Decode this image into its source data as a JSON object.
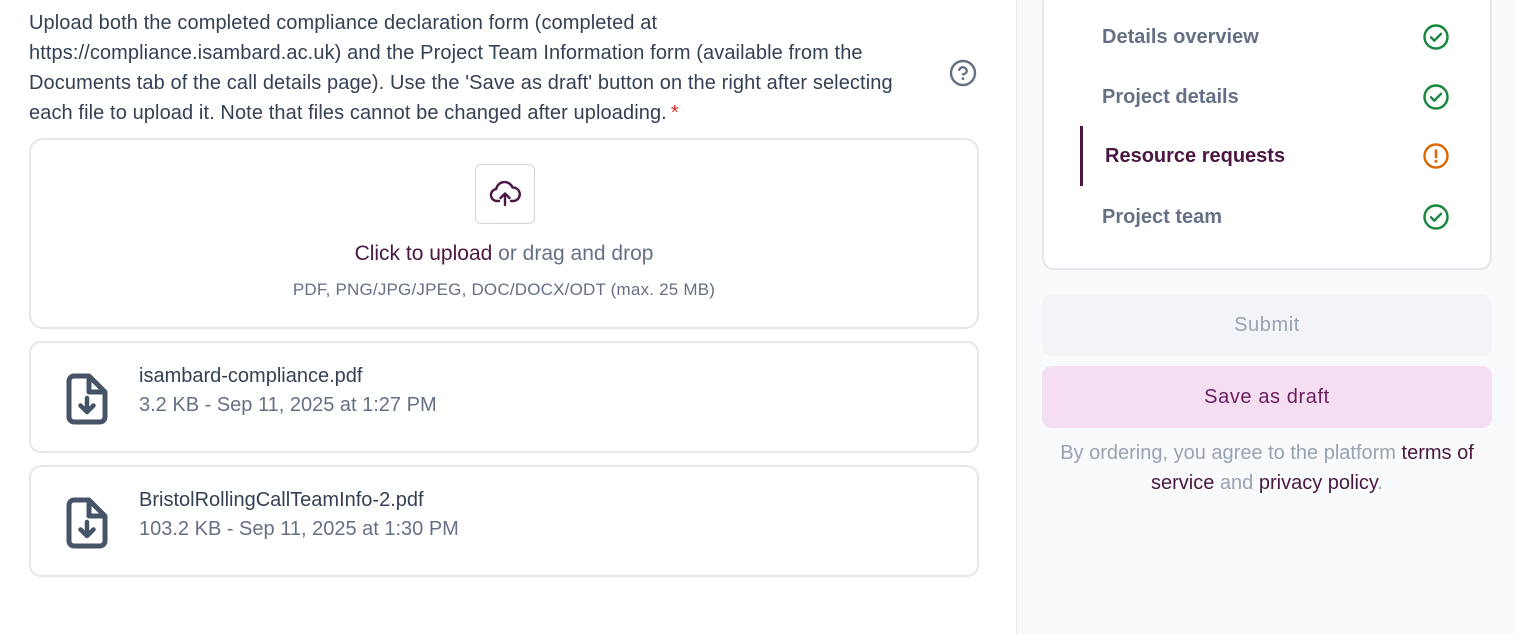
{
  "form": {
    "instructions": "Upload both the completed compliance declaration form (completed at https://compliance.isambard.ac.uk) and the Project Team Information form (available from the Documents tab of the call details page). Use the 'Save as draft' button on the right after selecting each file to upload it. Note that files cannot be changed after uploading.",
    "required_marker": "*",
    "dropzone": {
      "click_label": "Click to upload",
      "drag_label": " or drag and drop",
      "hint": "PDF, PNG/JPG/JPEG, DOC/DOCX/ODT (max. 25 MB)"
    },
    "files": [
      {
        "name": "isambard-compliance.pdf",
        "meta": "3.2 KB - Sep 11, 2025 at 1:27 PM"
      },
      {
        "name": "BristolRollingCallTeamInfo-2.pdf",
        "meta": "103.2 KB - Sep 11, 2025 at 1:30 PM"
      }
    ]
  },
  "sidebar": {
    "steps": [
      {
        "label": "Details overview",
        "status": "complete"
      },
      {
        "label": "Project details",
        "status": "complete"
      },
      {
        "label": "Resource requests",
        "status": "warning"
      },
      {
        "label": "Project team",
        "status": "complete"
      }
    ],
    "submit_label": "Submit",
    "draft_label": "Save as draft",
    "terms": {
      "prefix": "By ordering, you agree to the platform ",
      "tos": "terms of service",
      "and": " and ",
      "privacy": "privacy policy",
      "suffix": "."
    }
  },
  "colors": {
    "brand": "#4a1742",
    "success": "#16873c",
    "warning": "#dc6803",
    "draft_bg": "#f5ddf2"
  },
  "icons": {
    "help": "question-circle-icon",
    "upload": "cloud-upload-icon",
    "file": "file-download-icon",
    "complete": "check-circle-icon",
    "warning": "alert-circle-icon"
  }
}
